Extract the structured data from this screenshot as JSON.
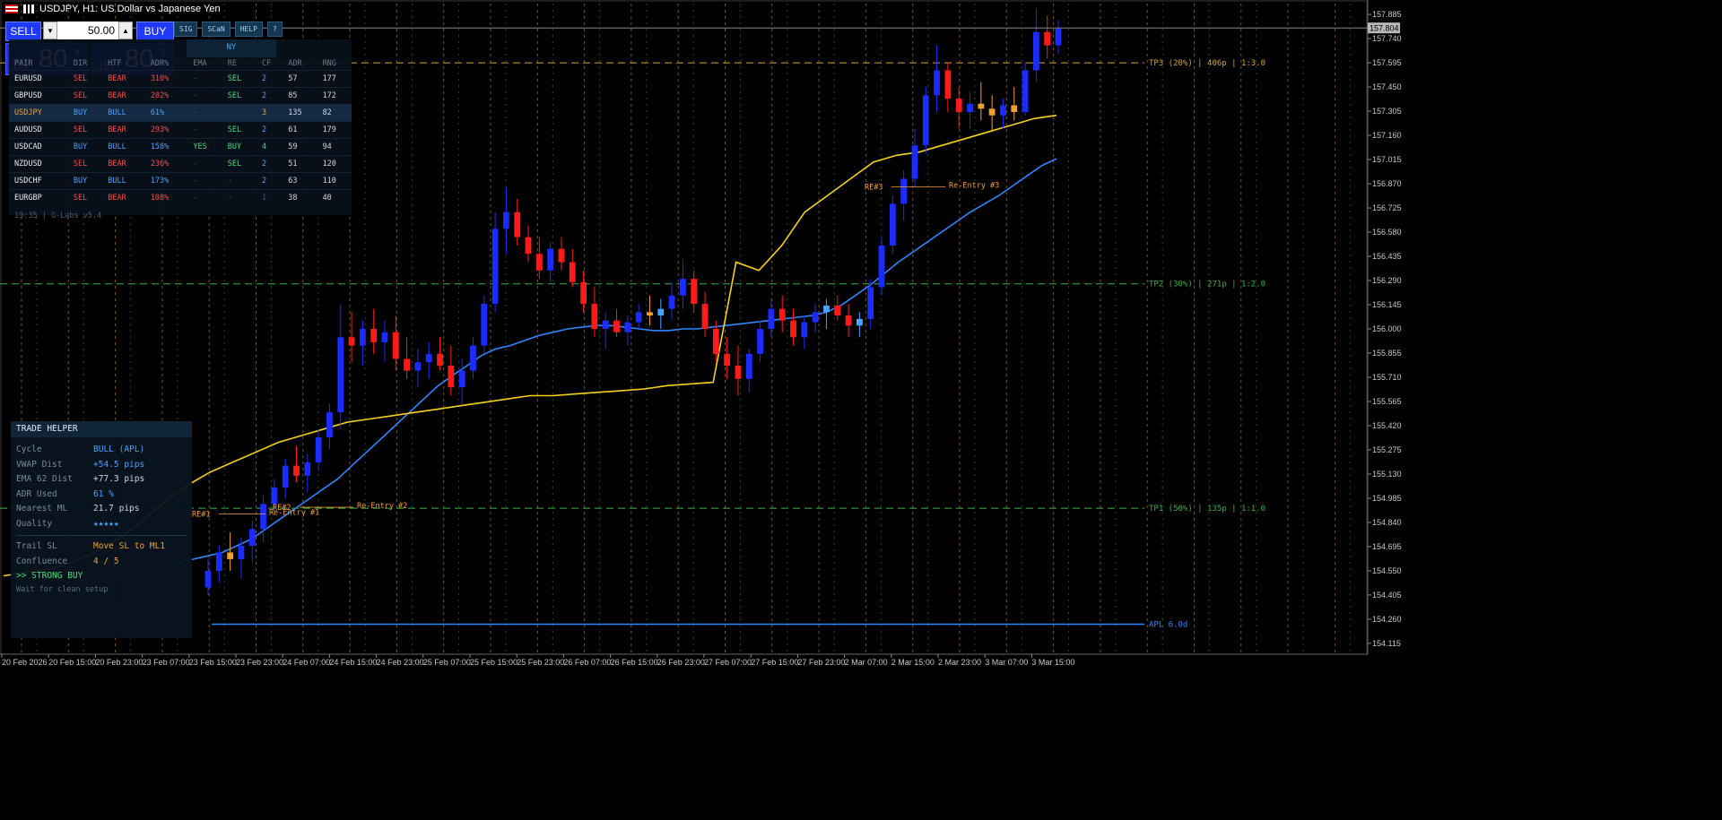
{
  "window": {
    "title": "USDJPY, H1:  US Dollar vs Japanese Yen"
  },
  "trade_panel": {
    "sell_label": "SELL",
    "buy_label": "BUY",
    "lot_value": "50.00",
    "sell_price_small": "157",
    "sell_price_big": "80",
    "sell_price_sup": "4",
    "buy_price_small": "157",
    "buy_price_big": "80",
    "buy_price_sup": "5"
  },
  "toolbar": [
    "SIG",
    "SCaN",
    "HELP",
    "?"
  ],
  "scanner": {
    "session_label": "NY",
    "columns": [
      "PAIR",
      "DIR",
      "HTF",
      "ADR%",
      "EMA",
      "RE",
      "CF",
      "ADR",
      "RNG"
    ],
    "rows": [
      {
        "pair": "EURUSD",
        "dir": "SEL",
        "htf": "BEAR",
        "adr_pct": "310%",
        "ema": "-",
        "re": "SEL",
        "cf": "2",
        "adr": "57",
        "rng": "177"
      },
      {
        "pair": "GBPUSD",
        "dir": "SEL",
        "htf": "BEAR",
        "adr_pct": "202%",
        "ema": "-",
        "re": "SEL",
        "cf": "2",
        "adr": "85",
        "rng": "172"
      },
      {
        "pair": "USDJPY",
        "dir": "BUY",
        "htf": "BULL",
        "adr_pct": "61%",
        "ema": "-",
        "re": "-",
        "cf": "3",
        "adr": "135",
        "rng": "82"
      },
      {
        "pair": "AUDUSD",
        "dir": "SEL",
        "htf": "BEAR",
        "adr_pct": "293%",
        "ema": "-",
        "re": "SEL",
        "cf": "2",
        "adr": "61",
        "rng": "179"
      },
      {
        "pair": "USDCAD",
        "dir": "BUY",
        "htf": "BULL",
        "adr_pct": "158%",
        "ema": "YES",
        "re": "BUY",
        "cf": "4",
        "adr": "59",
        "rng": "94"
      },
      {
        "pair": "NZDUSD",
        "dir": "SEL",
        "htf": "BEAR",
        "adr_pct": "236%",
        "ema": "-",
        "re": "SEL",
        "cf": "2",
        "adr": "51",
        "rng": "120"
      },
      {
        "pair": "USDCHF",
        "dir": "BUY",
        "htf": "BULL",
        "adr_pct": "173%",
        "ema": "-",
        "re": "-",
        "cf": "2",
        "adr": "63",
        "rng": "110"
      },
      {
        "pair": "EURGBP",
        "dir": "SEL",
        "htf": "BEAR",
        "adr_pct": "108%",
        "ema": "-",
        "re": "-",
        "cf": "1",
        "adr": "38",
        "rng": "40"
      }
    ],
    "footer": "19:35 | G-Labs v5.4"
  },
  "helper": {
    "title": "TRADE HELPER",
    "rows": [
      {
        "k": "Cycle",
        "v": "BULL  (APL)"
      },
      {
        "k": "VWAP Dist",
        "v": "+54.5 pips"
      },
      {
        "k": "EMA 62 Dist",
        "v": "+77.3 pips"
      },
      {
        "k": "ADR Used",
        "v": "61 %"
      },
      {
        "k": "Nearest ML",
        "v": "21.7 pips"
      },
      {
        "k": "Quality",
        "v": "★★★★★"
      }
    ],
    "rows2": [
      {
        "k": "Trail SL",
        "v": "Move SL to ML1"
      },
      {
        "k": "Confluence",
        "v": "4 / 5"
      }
    ],
    "signal": ">> STRONG BUY",
    "note": "Wait for clean setup"
  },
  "chart_data": {
    "type": "candlestick",
    "symbol": "USDJPY",
    "timeframe": "H1",
    "ylim": [
      154.05,
      157.95
    ],
    "y_ticks": [
      "157.885",
      "157.740",
      "157.595",
      "157.450",
      "157.305",
      "157.160",
      "157.015",
      "156.870",
      "156.725",
      "156.580",
      "156.435",
      "156.290",
      "156.145",
      "156.000",
      "155.855",
      "155.710",
      "155.565",
      "155.420",
      "155.275",
      "155.130",
      "154.985",
      "154.840",
      "154.695",
      "154.550",
      "154.405",
      "154.260",
      "154.115"
    ],
    "current_price": "157.804",
    "x_ticks": [
      "20 Feb 2026",
      "20 Feb 15:00",
      "20 Feb 23:00",
      "23 Feb 07:00",
      "23 Feb 15:00",
      "23 Feb 23:00",
      "24 Feb 07:00",
      "24 Feb 15:00",
      "24 Feb 23:00",
      "25 Feb 07:00",
      "25 Feb 15:00",
      "25 Feb 23:00",
      "26 Feb 07:00",
      "26 Feb 15:00",
      "26 Feb 23:00",
      "27 Feb 07:00",
      "27 Feb 15:00",
      "27 Feb 23:00",
      "2 Mar 07:00",
      "2 Mar 15:00",
      "2 Mar 23:00",
      "3 Mar 07:00",
      "3 Mar 15:00"
    ],
    "levels": [
      {
        "label": "TP3 (20%) | 406p | 1:3.0",
        "price": 157.595,
        "color": "#d9a520"
      },
      {
        "label": "TP2 (30%) | 271p | 1:2.0",
        "price": 156.27,
        "color": "#36b24a"
      },
      {
        "label": "TP1 (50%) | 135p | 1:1.0",
        "price": 154.925,
        "color": "#36b24a"
      },
      {
        "label": "APL 6.0d",
        "price": 154.23,
        "color": "#2f86ff"
      }
    ],
    "reentry_labels": [
      {
        "tag": "RE#1",
        "text": "Re-Entry #1"
      },
      {
        "tag": "RE#2",
        "text": "Re-Entry #2"
      },
      {
        "tag": "RE#3",
        "text": "Re-Entry #3"
      }
    ],
    "ohlc": [
      [
        154.45,
        154.62,
        154.4,
        154.55
      ],
      [
        154.55,
        154.7,
        154.48,
        154.66
      ],
      [
        154.66,
        154.78,
        154.55,
        154.62
      ],
      [
        154.62,
        154.75,
        154.5,
        154.7
      ],
      [
        154.7,
        154.85,
        154.6,
        154.8
      ],
      [
        154.8,
        155.0,
        154.72,
        154.95
      ],
      [
        154.95,
        155.1,
        154.88,
        155.05
      ],
      [
        155.05,
        155.22,
        154.98,
        155.18
      ],
      [
        155.18,
        155.3,
        155.08,
        155.12
      ],
      [
        155.12,
        155.25,
        155.02,
        155.2
      ],
      [
        155.2,
        155.4,
        155.15,
        155.35
      ],
      [
        155.35,
        155.55,
        155.28,
        155.5
      ],
      [
        155.5,
        156.15,
        155.4,
        155.95
      ],
      [
        155.95,
        156.1,
        155.8,
        155.9
      ],
      [
        155.9,
        156.05,
        155.78,
        156.0
      ],
      [
        156.0,
        156.12,
        155.85,
        155.92
      ],
      [
        155.92,
        156.05,
        155.8,
        155.98
      ],
      [
        155.98,
        156.08,
        155.75,
        155.82
      ],
      [
        155.82,
        155.95,
        155.7,
        155.75
      ],
      [
        155.75,
        155.88,
        155.65,
        155.8
      ],
      [
        155.8,
        155.92,
        155.7,
        155.85
      ],
      [
        155.85,
        155.95,
        155.75,
        155.78
      ],
      [
        155.78,
        155.9,
        155.6,
        155.65
      ],
      [
        155.65,
        155.82,
        155.55,
        155.75
      ],
      [
        155.75,
        155.95,
        155.7,
        155.9
      ],
      [
        155.9,
        156.2,
        155.85,
        156.15
      ],
      [
        156.15,
        156.7,
        156.1,
        156.6
      ],
      [
        156.6,
        156.85,
        156.45,
        156.7
      ],
      [
        156.7,
        156.78,
        156.5,
        156.55
      ],
      [
        156.55,
        156.62,
        156.4,
        156.45
      ],
      [
        156.45,
        156.55,
        156.3,
        156.35
      ],
      [
        156.35,
        156.52,
        156.28,
        156.48
      ],
      [
        156.48,
        156.55,
        156.35,
        156.4
      ],
      [
        156.4,
        156.48,
        156.25,
        156.28
      ],
      [
        156.28,
        156.35,
        156.1,
        156.15
      ],
      [
        156.15,
        156.25,
        155.95,
        156.0
      ],
      [
        156.0,
        156.1,
        155.88,
        156.05
      ],
      [
        156.05,
        156.12,
        155.95,
        155.98
      ],
      [
        155.98,
        156.08,
        155.9,
        156.04
      ],
      [
        156.04,
        156.15,
        156.0,
        156.1
      ],
      [
        156.1,
        156.2,
        156.02,
        156.08
      ],
      [
        156.08,
        156.18,
        156.0,
        156.12
      ],
      [
        156.12,
        156.28,
        156.05,
        156.2
      ],
      [
        156.2,
        156.42,
        156.12,
        156.3
      ],
      [
        156.3,
        156.35,
        156.1,
        156.15
      ],
      [
        156.15,
        156.22,
        155.95,
        156.0
      ],
      [
        156.0,
        156.05,
        155.8,
        155.85
      ],
      [
        155.85,
        155.95,
        155.7,
        155.78
      ],
      [
        155.78,
        155.9,
        155.6,
        155.7
      ],
      [
        155.7,
        155.88,
        155.62,
        155.85
      ],
      [
        155.85,
        156.05,
        155.8,
        156.0
      ],
      [
        156.0,
        156.18,
        155.95,
        156.12
      ],
      [
        156.12,
        156.2,
        155.98,
        156.05
      ],
      [
        156.05,
        156.12,
        155.9,
        155.95
      ],
      [
        155.95,
        156.08,
        155.88,
        156.04
      ],
      [
        156.04,
        156.15,
        155.98,
        156.1
      ],
      [
        156.1,
        156.18,
        156.0,
        156.14
      ],
      [
        156.14,
        156.2,
        156.05,
        156.08
      ],
      [
        156.08,
        156.15,
        155.95,
        156.02
      ],
      [
        156.02,
        156.1,
        155.95,
        156.06
      ],
      [
        156.06,
        156.3,
        156.0,
        156.25
      ],
      [
        156.25,
        156.55,
        156.2,
        156.5
      ],
      [
        156.5,
        156.8,
        156.45,
        156.75
      ],
      [
        156.75,
        156.95,
        156.65,
        156.9
      ],
      [
        156.9,
        157.2,
        156.85,
        157.1
      ],
      [
        157.1,
        157.45,
        157.05,
        157.4
      ],
      [
        157.4,
        157.7,
        157.3,
        157.55
      ],
      [
        157.55,
        157.6,
        157.3,
        157.38
      ],
      [
        157.38,
        157.45,
        157.2,
        157.3
      ],
      [
        157.3,
        157.42,
        157.2,
        157.35
      ],
      [
        157.35,
        157.48,
        157.25,
        157.32
      ],
      [
        157.32,
        157.4,
        157.18,
        157.28
      ],
      [
        157.28,
        157.38,
        157.2,
        157.34
      ],
      [
        157.34,
        157.45,
        157.25,
        157.3
      ],
      [
        157.3,
        157.6,
        157.28,
        157.55
      ],
      [
        157.55,
        157.92,
        157.48,
        157.78
      ],
      [
        157.78,
        157.88,
        157.62,
        157.7
      ],
      [
        157.7,
        157.85,
        157.65,
        157.8
      ]
    ],
    "series": [
      {
        "name": "EMA 62",
        "color": "#2f86ff",
        "values": [
          154.6,
          154.62,
          154.64,
          154.66,
          154.7,
          154.74,
          154.8,
          154.86,
          154.92,
          154.98,
          155.04,
          155.1,
          155.18,
          155.26,
          155.34,
          155.42,
          155.5,
          155.58,
          155.66,
          155.72,
          155.78,
          155.84,
          155.88,
          155.9,
          155.93,
          155.96,
          155.98,
          156.0,
          156.01,
          156.02,
          156.02,
          156.01,
          156.0,
          155.99,
          155.99,
          156.0,
          156.0,
          156.01,
          156.02,
          156.03,
          156.04,
          156.05,
          156.06,
          156.07,
          156.08,
          156.1,
          156.14,
          156.2,
          156.26,
          156.33,
          156.4,
          156.46,
          156.52,
          156.58,
          156.64,
          156.7,
          156.75,
          156.8,
          156.86,
          156.92,
          156.98,
          157.02
        ]
      },
      {
        "name": "VWAP",
        "color": "#f5d21a",
        "values": [
          154.52,
          154.54,
          154.56,
          154.6,
          154.66,
          154.74,
          154.84,
          154.96,
          155.06,
          155.14,
          155.2,
          155.26,
          155.32,
          155.36,
          155.4,
          155.44,
          155.46,
          155.48,
          155.5,
          155.52,
          155.54,
          155.56,
          155.58,
          155.6,
          155.6,
          155.61,
          155.62,
          155.63,
          155.64,
          155.66,
          155.67,
          155.68,
          156.4,
          156.35,
          156.5,
          156.7,
          156.8,
          156.9,
          157.0,
          157.04,
          157.06,
          157.1,
          157.14,
          157.18,
          157.22,
          157.26,
          157.28
        ]
      }
    ]
  }
}
